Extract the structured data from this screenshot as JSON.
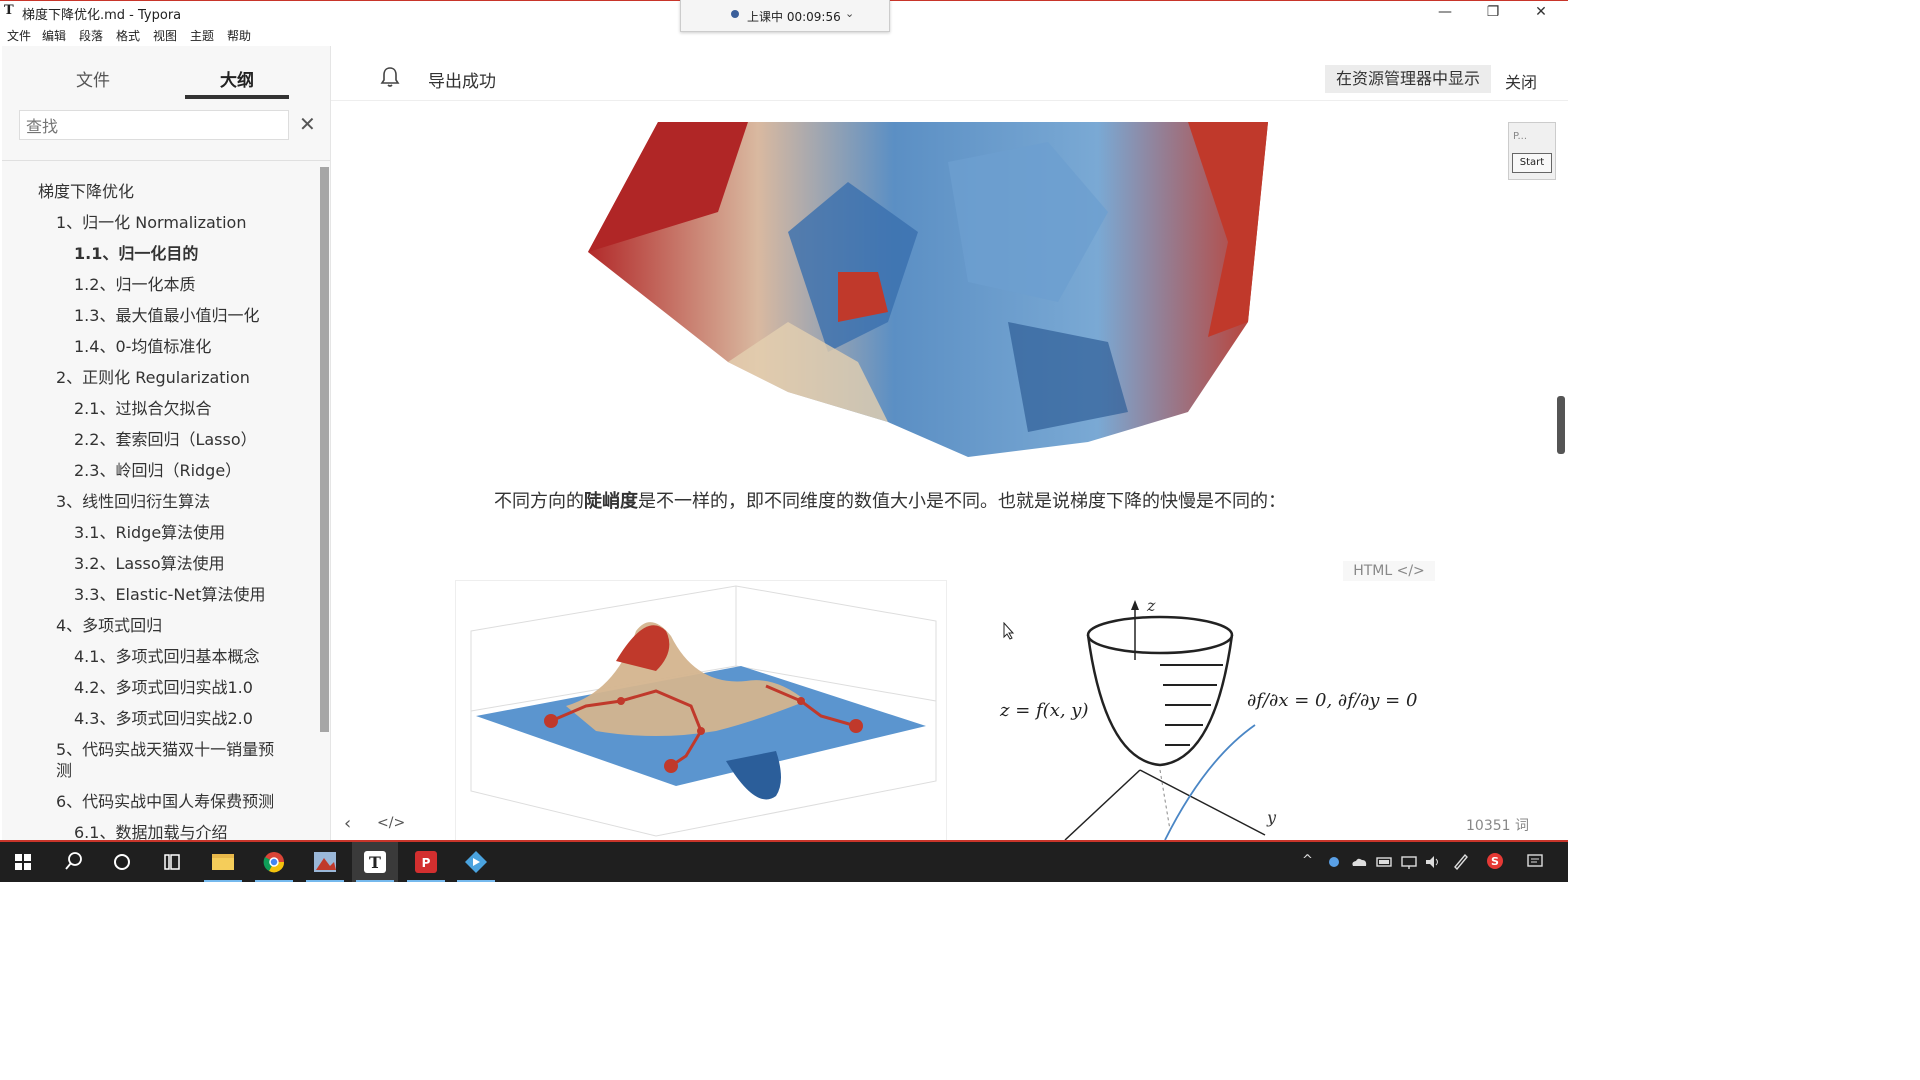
{
  "window": {
    "app_icon": "T",
    "title": "梯度下降优化.md - Typora",
    "minimize": "—",
    "maximize": "❐",
    "close": "✕"
  },
  "menu": [
    "文件",
    "编辑",
    "段落",
    "格式",
    "视图",
    "主题",
    "帮助"
  ],
  "recording": {
    "status": "上课中 00:09:56",
    "chevron": "⌄"
  },
  "sidebar": {
    "tabs": [
      {
        "label": "文件",
        "active": false
      },
      {
        "label": "大纲",
        "active": true
      }
    ],
    "search": {
      "placeholder": "查找",
      "close": "✕"
    },
    "outline": [
      {
        "label": "梯度下降优化",
        "level": 1
      },
      {
        "label": "1、归一化 Normalization",
        "level": 2
      },
      {
        "label": "1.1、归一化目的",
        "level": 3,
        "active": true
      },
      {
        "label": "1.2、归一化本质",
        "level": 3
      },
      {
        "label": "1.3、最大值最小值归一化",
        "level": 3
      },
      {
        "label": "1.4、0-均值标准化",
        "level": 3
      },
      {
        "label": "2、正则化 Regularization",
        "level": 2
      },
      {
        "label": "2.1、过拟合欠拟合",
        "level": 3
      },
      {
        "label": "2.2、套索回归（Lasso）",
        "level": 3
      },
      {
        "label": "2.3、岭回归（Ridge）",
        "level": 3
      },
      {
        "label": "3、线性回归衍生算法",
        "level": 2
      },
      {
        "label": "3.1、Ridge算法使用",
        "level": 3
      },
      {
        "label": "3.2、Lasso算法使用",
        "level": 3
      },
      {
        "label": "3.3、Elastic-Net算法使用",
        "level": 3
      },
      {
        "label": "4、多项式回归",
        "level": 2
      },
      {
        "label": "4.1、多项式回归基本概念",
        "level": 3
      },
      {
        "label": "4.2、多项式回归实战1.0",
        "level": 3
      },
      {
        "label": "4.3、多项式回归实战2.0",
        "level": 3
      },
      {
        "label": "5、代码实战天猫双十一销量预",
        "level": 2
      },
      {
        "label": "测",
        "level": 2
      },
      {
        "label": "6、代码实战中国人寿保费预测",
        "level": 2
      },
      {
        "label": "6.1、数据加载与介绍",
        "level": 3
      }
    ]
  },
  "header": {
    "notice": "导出成功",
    "reveal_button": "在资源管理器中显示",
    "close_button": "关闭"
  },
  "content": {
    "para_before": "不同方向的",
    "para_bold": "陡峭度",
    "para_after": "是不一样的，即不同维度的数值大小是不同。也就是说梯度下降的快慢是不同的：",
    "html_badge": "HTML </>",
    "formula_z": "z = f(x, y)",
    "formula_partials": "∂f/∂x = 0,  ∂f/∂y = 0",
    "axis_z": "z",
    "axis_y": "y"
  },
  "mini_panel": {
    "label": "P...",
    "start": "Start"
  },
  "footer": {
    "prev": "‹",
    "source_toggle": "</>",
    "word_count": "10351 词"
  },
  "colors": {
    "accent_red": "#c8352a",
    "taskbar": "#1f1f1f",
    "sidebar_bg": "#f7f7f7"
  }
}
